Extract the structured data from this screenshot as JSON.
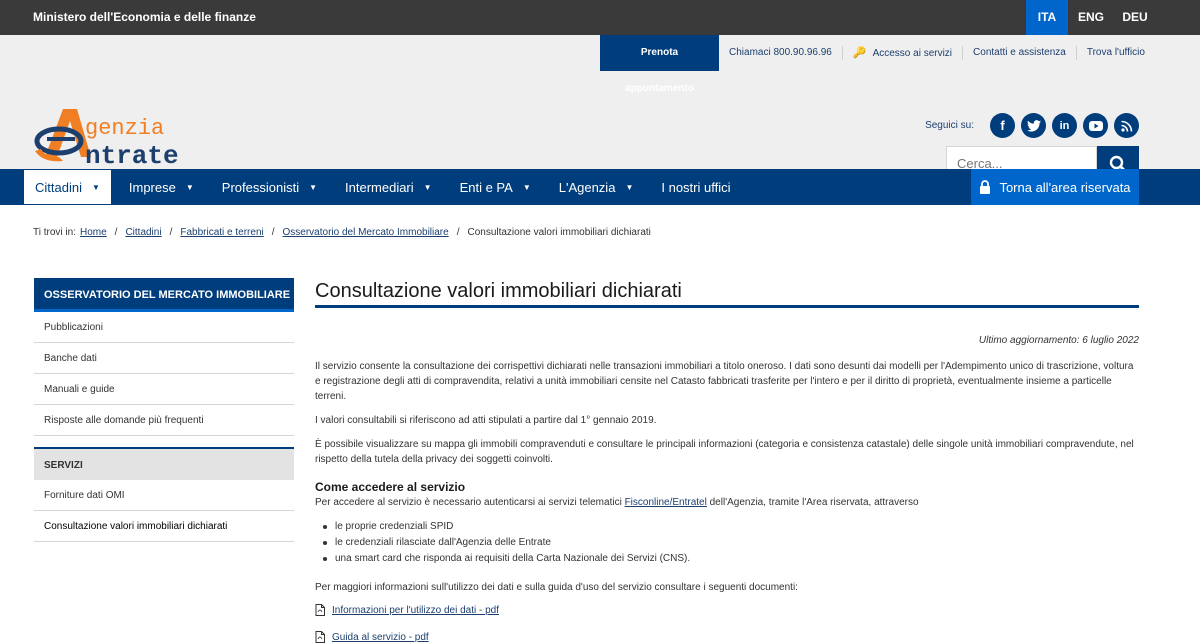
{
  "topbar": {
    "ministry": "Ministero dell'Economia e delle finanze",
    "languages": [
      "ITA",
      "ENG",
      "DEU"
    ]
  },
  "header": {
    "prenota": "Prenota appuntamento",
    "chiamaci": "Chiamaci 800.90.96.96",
    "accesso": "Accesso ai servizi",
    "contatti": "Contatti e assistenza",
    "trova": "Trova l'ufficio",
    "seguici": "Seguici su:",
    "logo_line1": "genzia",
    "logo_line2": "ntrate",
    "search_placeholder": "Cerca...",
    "social_icons": [
      "facebook-icon",
      "twitter-icon",
      "linkedin-icon",
      "youtube-icon",
      "rss-icon"
    ]
  },
  "nav": {
    "items": [
      "Cittadini",
      "Imprese",
      "Professionisti",
      "Intermediari",
      "Enti e PA",
      "L'Agenzia",
      "I nostri uffici"
    ],
    "area": "Torna all'area riservata"
  },
  "breadcrumb": {
    "prefix": "Ti trovi in:",
    "items": [
      "Home",
      "Cittadini",
      "Fabbricati e terreni",
      "Osservatorio del Mercato Immobiliare",
      "Consultazione valori immobiliari dichiarati"
    ]
  },
  "sidebar": {
    "title": "OSSERVATORIO DEL MERCATO IMMOBILIARE",
    "items": [
      "Pubblicazioni",
      "Banche dati",
      "Manuali e guide",
      "Risposte alle domande più frequenti"
    ],
    "section": "SERVIZI",
    "section_items": [
      "Forniture dati OMI",
      "Consultazione valori immobiliari dichiarati"
    ]
  },
  "content": {
    "title": "Consultazione valori immobiliari dichiarati",
    "updated": "Ultimo aggiornamento: 6 luglio 2022",
    "p1": "Il servizio consente la consultazione dei corrispettivi dichiarati nelle transazioni immobiliari a titolo oneroso. I dati sono desunti dai modelli per l'Adempimento unico di trascrizione, voltura e registrazione degli atti di compravendita, relativi a unità immobiliari censite nel Catasto fabbricati trasferite per l'intero e per il diritto di proprietà, eventualmente insieme a particelle terreni.",
    "p2": "I valori consultabili si riferiscono ad atti stipulati a partire dal 1° gennaio 2019.",
    "p3": "È possibile visualizzare su mappa gli immobili compravenduti e consultare le principali informazioni (categoria e consistenza catastale) delle singole unità immobiliari compravendute, nel rispetto della tutela della privacy dei soggetti coinvolti.",
    "h2": "Come accedere al servizio",
    "p4_before": "Per accedere al servizio è necessario autenticarsi ai servizi telematici ",
    "p4_link": "Fisconline/Entratel",
    "p4_after": " dell'Agenzia, tramite l'Area riservata, attraverso",
    "bullets": [
      "le proprie credenziali SPID",
      "le credenziali rilasciate dall'Agenzia delle Entrate",
      "una smart card che risponda ai requisiti della Carta Nazionale dei Servizi (CNS)."
    ],
    "p5": "Per maggiori informazioni sull'utilizzo dei dati e sulla guida d'uso del servizio consultare i seguenti documenti:",
    "docs": [
      "Informazioni per l'utilizzo dei dati - pdf",
      "Guida al servizio - pdf"
    ]
  },
  "colors": {
    "dark_blue": "#003d7c",
    "bright_blue": "#0066cc",
    "topbar": "#3a3a3a",
    "header_bg": "#efefef",
    "logo_orange": "#f07f24"
  }
}
